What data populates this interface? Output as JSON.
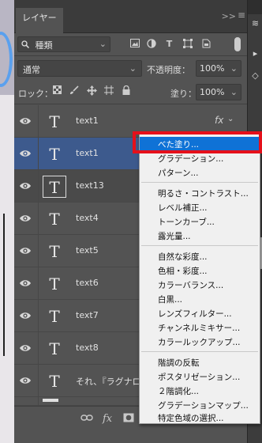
{
  "panel": {
    "tab_label": "レイヤー",
    "tab_collapse": ">>",
    "tab_menu": "≡"
  },
  "filter": {
    "kind_label": "種類",
    "icons": [
      "image-filter-icon",
      "adjustment-filter-icon",
      "type-filter-icon",
      "shape-filter-icon",
      "smart-object-filter-icon"
    ]
  },
  "blend": {
    "mode": "通常",
    "opacity_label": "不透明度：",
    "opacity_value": "100%"
  },
  "lock": {
    "label": "ロック：",
    "fill_label": "塗り：",
    "fill_value": "100%"
  },
  "layers": [
    {
      "name": "text1",
      "thumb": "T",
      "fx": "fx",
      "state": "normal"
    },
    {
      "name": "text1",
      "thumb": "T",
      "fx": "",
      "state": "selected-blue"
    },
    {
      "name": "text13",
      "thumb": "T",
      "fx": "",
      "state": "selected"
    },
    {
      "name": "text4",
      "thumb": "T",
      "fx": "",
      "state": "normal"
    },
    {
      "name": "text5",
      "thumb": "T",
      "fx": "",
      "state": "normal"
    },
    {
      "name": "text6",
      "thumb": "T",
      "fx": "",
      "state": "normal"
    },
    {
      "name": "text7",
      "thumb": "T",
      "fx": "",
      "state": "normal"
    },
    {
      "name": "text8",
      "thumb": "T",
      "fx": "",
      "state": "normal"
    },
    {
      "name": "それ、『ラグナロ...",
      "thumb": "T",
      "fx": "",
      "state": "normal"
    }
  ],
  "bottom": {
    "fx_label": "fx"
  },
  "menu": {
    "highlight_color": "#0f72d6",
    "items": [
      {
        "label": "べた塗り...",
        "highlighted": true
      },
      {
        "label": "グラデーション...",
        "highlighted": false
      },
      {
        "label": "パターン...",
        "highlighted": false
      },
      {
        "label": "明るさ・コントラスト...",
        "highlighted": false
      },
      {
        "label": "レベル補正...",
        "highlighted": false
      },
      {
        "label": "トーンカーブ...",
        "highlighted": false
      },
      {
        "label": "露光量...",
        "highlighted": false
      },
      {
        "label": "自然な彩度...",
        "highlighted": false
      },
      {
        "label": "色相・彩度...",
        "highlighted": false
      },
      {
        "label": "カラーバランス...",
        "highlighted": false
      },
      {
        "label": "白黒...",
        "highlighted": false
      },
      {
        "label": "レンズフィルター...",
        "highlighted": false
      },
      {
        "label": "チャンネルミキサー...",
        "highlighted": false
      },
      {
        "label": "カラールックアップ...",
        "highlighted": false
      },
      {
        "label": "階調の反転",
        "highlighted": false
      },
      {
        "label": "ポスタリゼーション...",
        "highlighted": false
      },
      {
        "label": "２階調化...",
        "highlighted": false
      },
      {
        "label": "グラデーションマップ...",
        "highlighted": false
      },
      {
        "label": "特定色域の選択...",
        "highlighted": false
      }
    ]
  },
  "annotation": {
    "highlight_box_color": "#e5101a"
  }
}
